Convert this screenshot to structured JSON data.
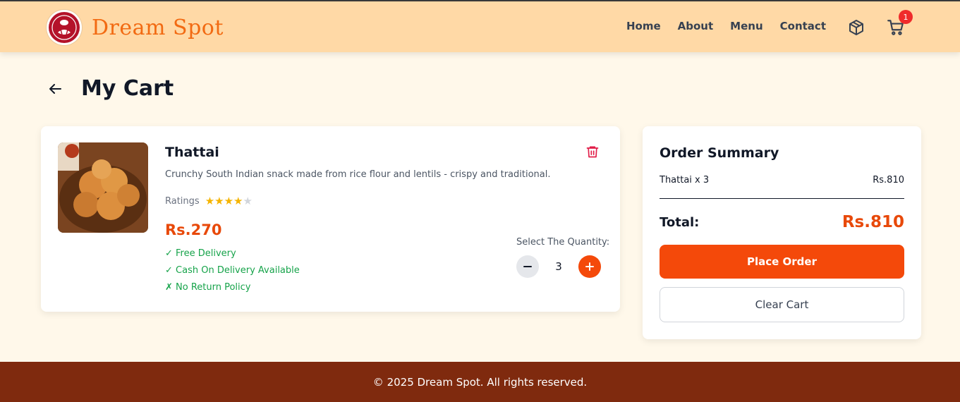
{
  "header": {
    "brand": "Dream Spot",
    "nav": [
      "Home",
      "About",
      "Menu",
      "Contact"
    ],
    "orders_icon": "package-icon",
    "cart_icon": "cart-icon",
    "cart_count": "1"
  },
  "page": {
    "title": "My Cart",
    "back_icon": "arrow-left-icon"
  },
  "cart_item": {
    "name": "Thattai",
    "description": "Crunchy South Indian snack made from rice flour and lentils - crispy and traditional.",
    "ratings_label": "Ratings",
    "rating": 4,
    "rating_max": 5,
    "price": "Rs.270",
    "perks": [
      "✓ Free Delivery",
      "✓ Cash On Delivery Available",
      "✗ No Return Policy"
    ],
    "quantity_label": "Select The Quantity:",
    "quantity": "3",
    "delete_icon": "trash-icon"
  },
  "summary": {
    "title": "Order Summary",
    "line_label": "Thattai x 3",
    "line_value": "Rs.810",
    "total_label": "Total:",
    "total_value": "Rs.810",
    "place_order": "Place Order",
    "clear_cart": "Clear Cart"
  },
  "footer": {
    "text": "© 2025 Dream Spot. All rights reserved."
  },
  "colors": {
    "accent": "#f4490a",
    "header_bg": "#ffd9a6",
    "page_bg": "#fff8ea",
    "footer_bg": "#7f2a0e",
    "success": "#16a34a",
    "brand_text": "#f26a12"
  }
}
